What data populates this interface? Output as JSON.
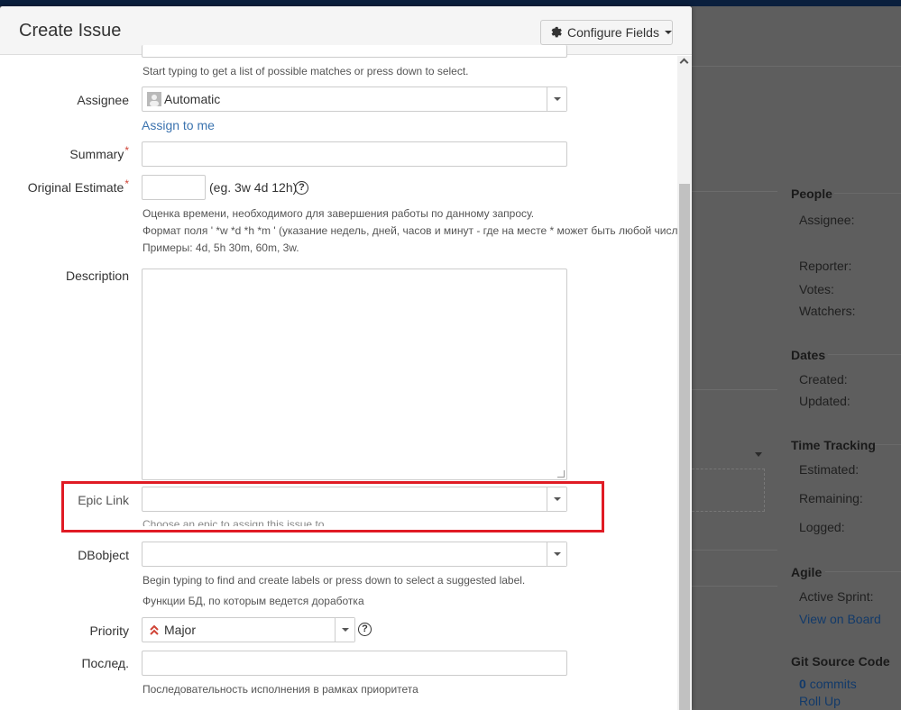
{
  "dialog": {
    "title": "Create Issue",
    "configure_fields_label": "Configure Fields"
  },
  "form": {
    "top_hint": "Start typing to get a list of possible matches or press down to select.",
    "assignee": {
      "label": "Assignee",
      "value": "Automatic",
      "assign_to_me": "Assign to me"
    },
    "summary": {
      "label": "Summary",
      "required": "*",
      "value": ""
    },
    "original_estimate": {
      "label": "Original Estimate",
      "required": "*",
      "value": "",
      "example": "(eg. 3w 4d 12h)",
      "help": "?",
      "hint_1": "Оценка времени, необходимого для завершения работы по данному запросу.",
      "hint_2": "Формат поля ' *w *d *h *m ' (указание недель, дней, часов и минут - где на месте * может быть любой число)",
      "hint_3": "Примеры: 4d, 5h 30m, 60m, 3w."
    },
    "description": {
      "label": "Description",
      "value": ""
    },
    "epic_link": {
      "label": "Epic Link",
      "value": "",
      "hint": "Choose an epic to assign this issue to."
    },
    "dbobject": {
      "label": "DBobject",
      "value": "",
      "hint_1": "Begin typing to find and create labels or press down to select a suggested label.",
      "hint_2": "Функции БД, по которым ведется доработка"
    },
    "priority": {
      "label": "Priority",
      "value": "Major",
      "help": "?"
    },
    "posled": {
      "label": "Послед.",
      "value": "",
      "hint": "Последовательность исполнения в рамках приоритета"
    }
  },
  "background": {
    "people_heading": "People",
    "assignee_label": "Assignee:",
    "reporter_label": "Reporter:",
    "votes_label": "Votes:",
    "watchers_label": "Watchers:",
    "dates_heading": "Dates",
    "created_label": "Created:",
    "updated_label": "Updated:",
    "time_tracking_heading": "Time Tracking",
    "estimated_label": "Estimated:",
    "remaining_label": "Remaining:",
    "logged_label": "Logged:",
    "agile_heading": "Agile",
    "active_sprint_label": "Active Sprint:",
    "view_on_board": "View on Board",
    "git_heading": "Git Source Code",
    "commits_count": "0",
    "commits_label": "commits",
    "roll_up": "Roll Up"
  },
  "colors": {
    "link": "#3b73af",
    "required": "#d04437",
    "highlight_box": "#e01b24",
    "priority_icon": "#d04437"
  }
}
